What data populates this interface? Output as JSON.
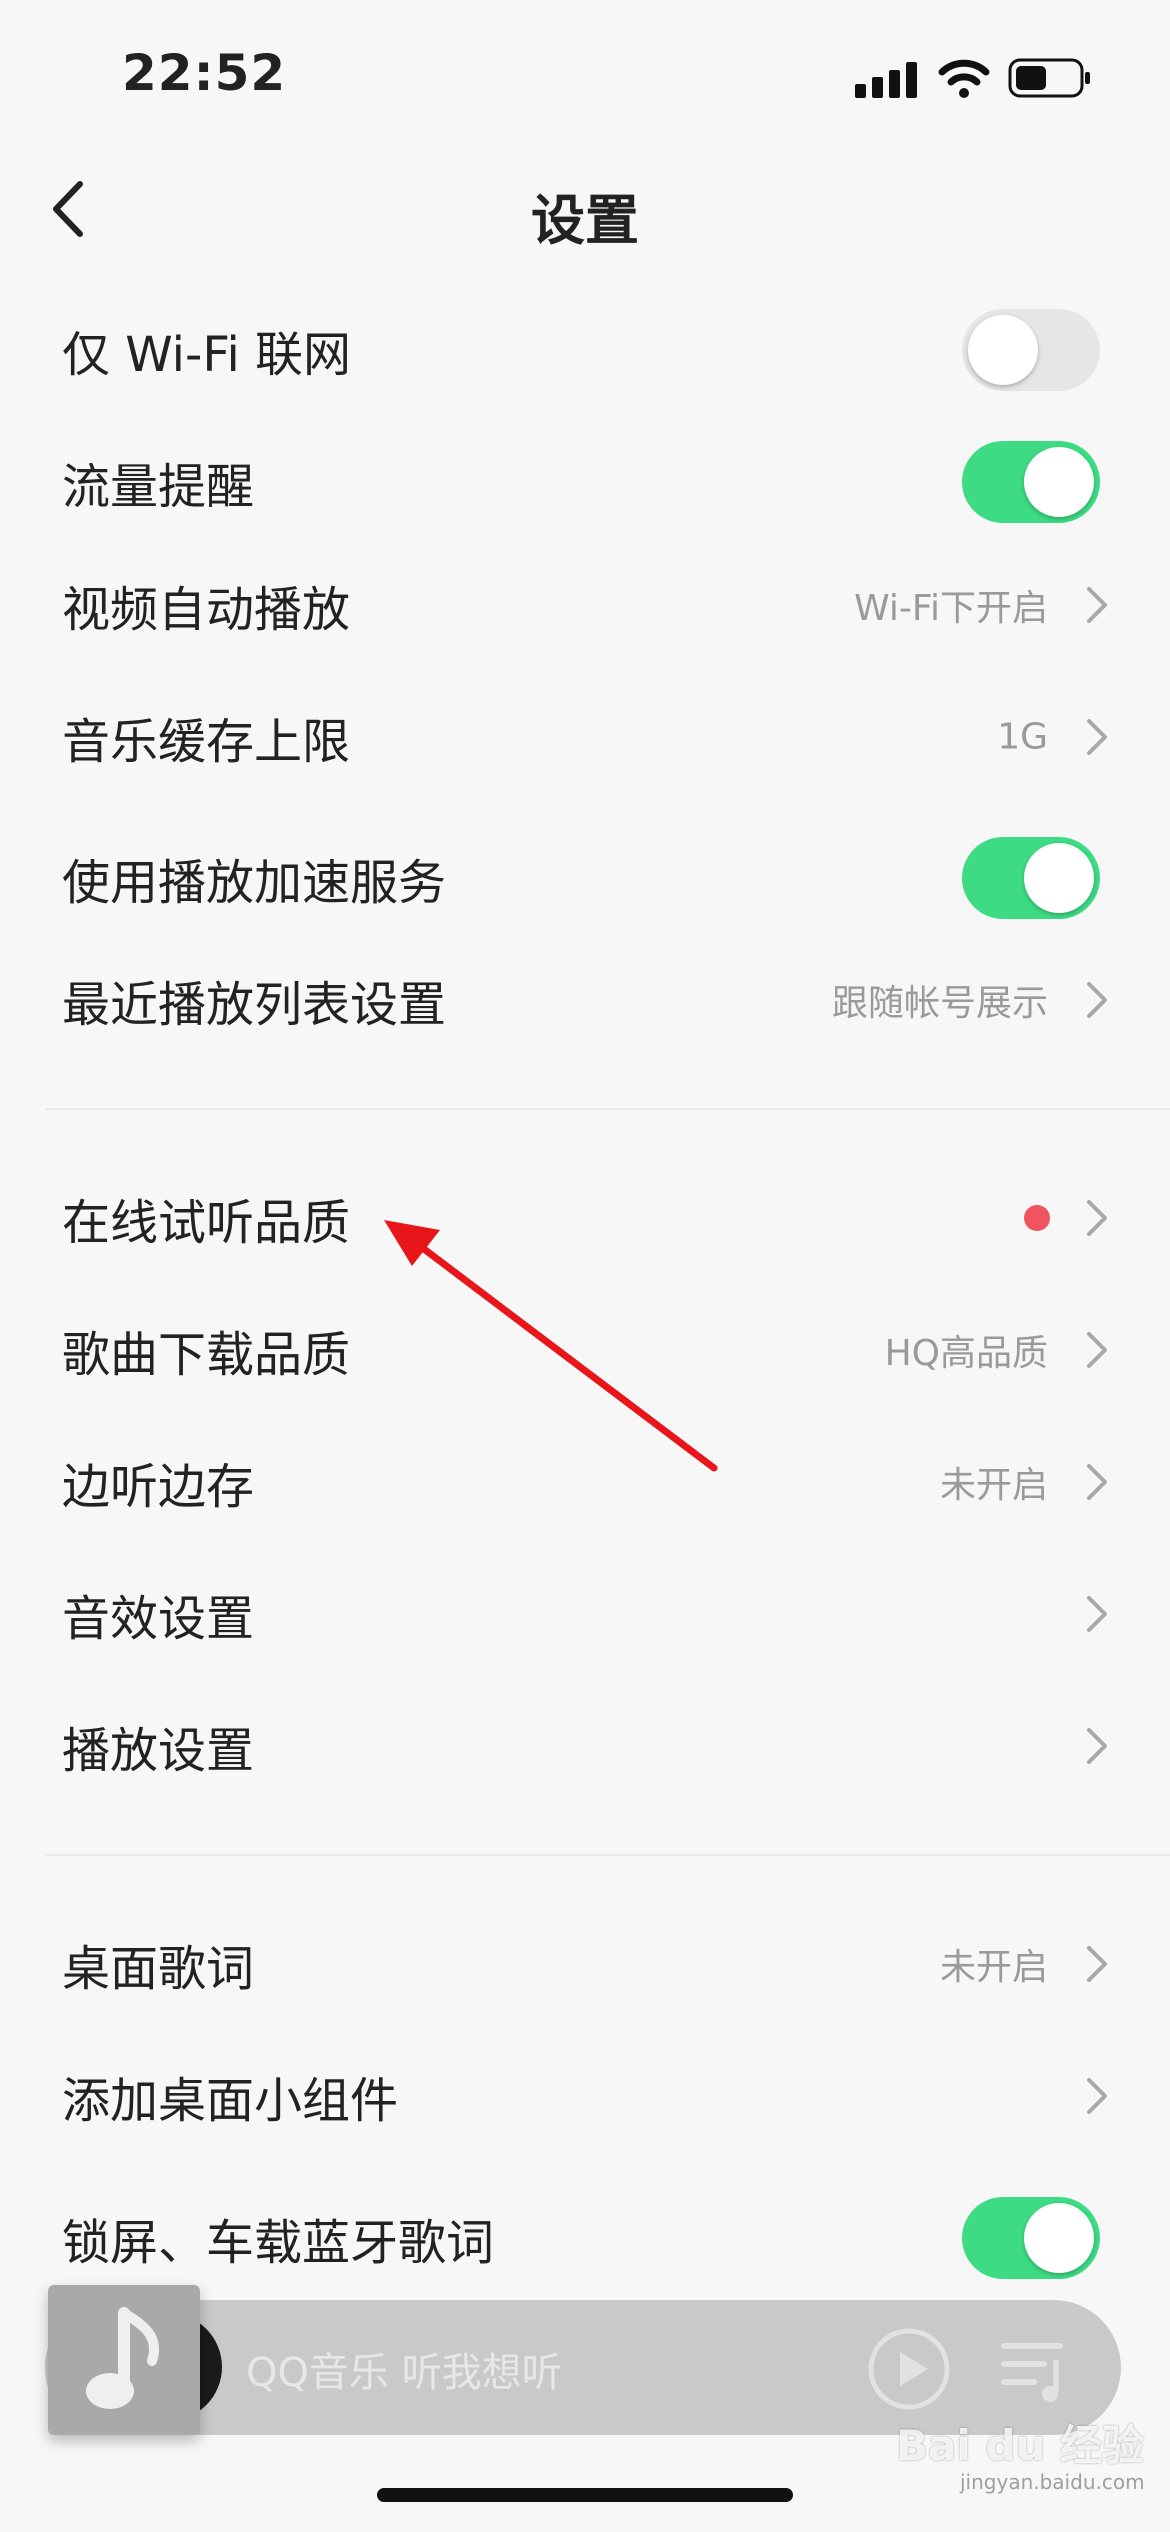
{
  "status_bar": {
    "time": "22:52"
  },
  "nav": {
    "title": "设置"
  },
  "section1": [
    {
      "label": "仅 Wi-Fi 联网",
      "toggle": false
    },
    {
      "label": "流量提醒",
      "toggle": true
    },
    {
      "label": "视频自动播放",
      "value": "Wi-Fi下开启"
    },
    {
      "label": "音乐缓存上限",
      "value": "1G"
    },
    {
      "label": "使用播放加速服务",
      "toggle": true
    },
    {
      "label": "最近播放列表设置",
      "value": "跟随帐号展示"
    }
  ],
  "section2": [
    {
      "label": "在线试听品质",
      "badge": "red-dot"
    },
    {
      "label": "歌曲下载品质",
      "value": "HQ高品质"
    },
    {
      "label": "边听边存",
      "value": "未开启"
    },
    {
      "label": "音效设置"
    },
    {
      "label": "播放设置"
    }
  ],
  "section3": [
    {
      "label": "桌面歌词",
      "value": "未开启"
    },
    {
      "label": "添加桌面小组件"
    },
    {
      "label": "锁屏、车载蓝牙歌词",
      "toggle": true
    }
  ],
  "mini_player": {
    "text": "QQ音乐 听我想听"
  },
  "watermark": {
    "text": "Bai du 经验",
    "sub": "jingyan.baidu.com"
  },
  "colors": {
    "toggle_on": "#3ddc84",
    "toggle_off": "#e6e6e6",
    "badge": "#f0555f",
    "annotation_arrow": "#e8161b"
  }
}
